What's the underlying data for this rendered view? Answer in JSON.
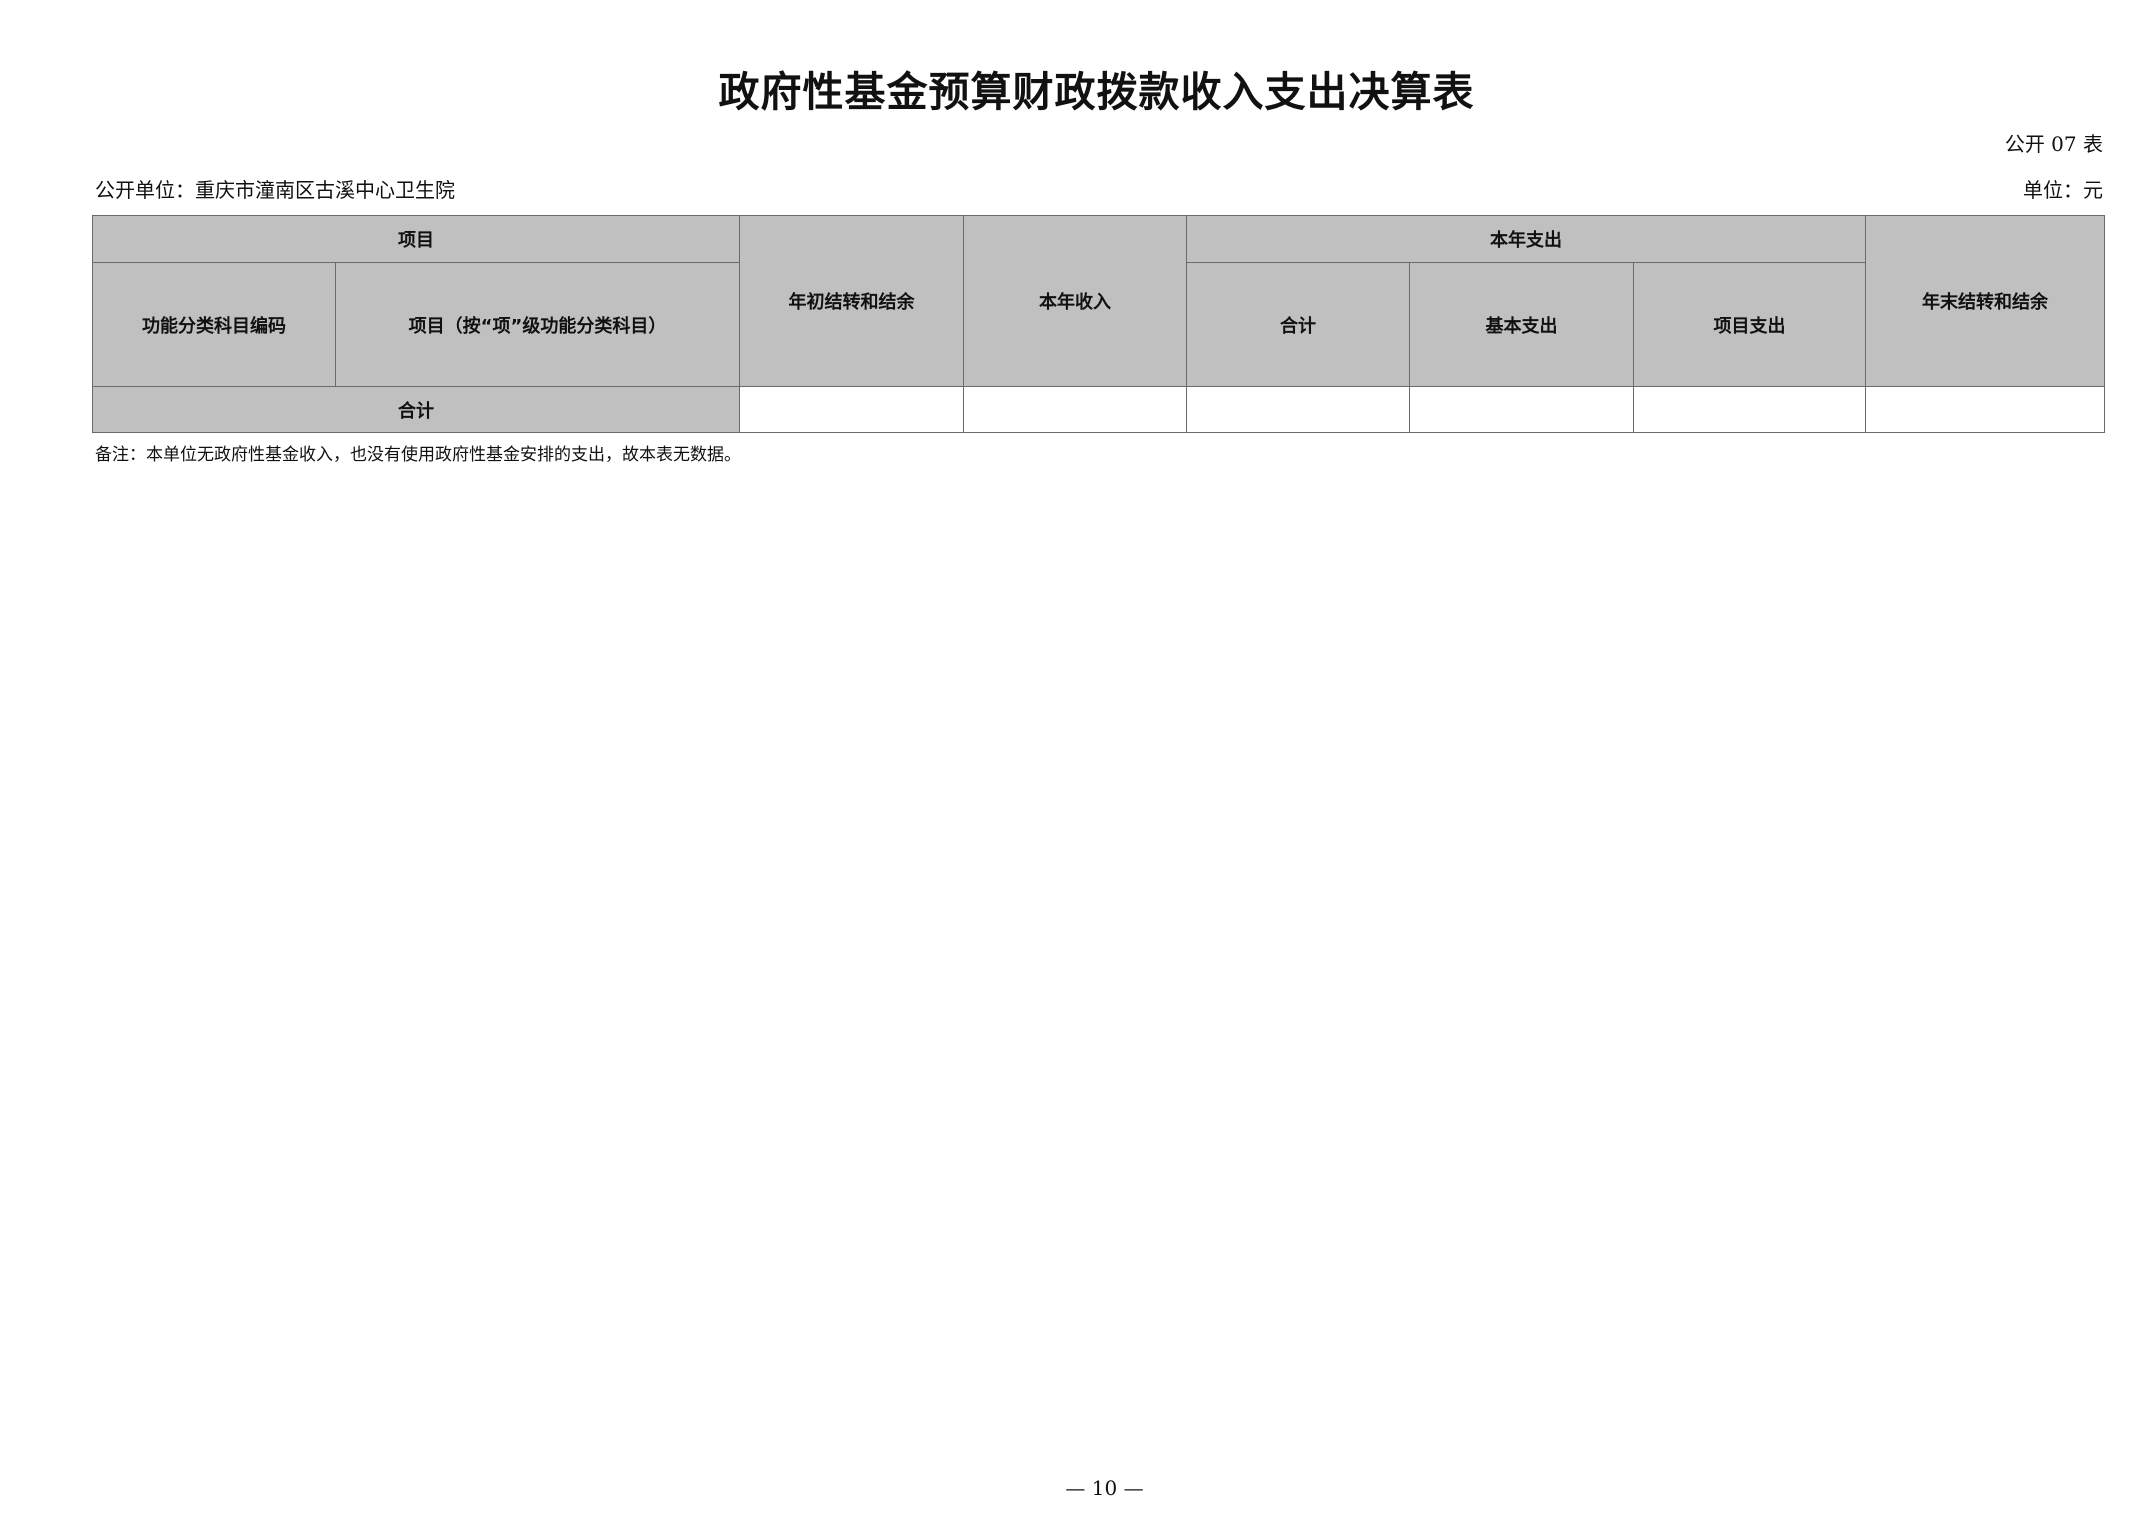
{
  "title": "政府性基金预算财政拨款收入支出决算表",
  "form_code": "公开 07 表",
  "unit_label": "公开单位：",
  "unit_name": "重庆市潼南区古溪中心卫生院",
  "currency_label": "单位：",
  "currency": "元",
  "table": {
    "header": {
      "item_group": "项目",
      "function_code": "功能分类科目编码",
      "item_name": "项目（按“项”级功能分类科目）",
      "opening_balance": "年初结转和结余",
      "current_income": "本年收入",
      "current_expense_group": "本年支出",
      "expense_total": "合计",
      "basic_expense": "基本支出",
      "project_expense": "项目支出",
      "closing_balance": "年末结转和结余"
    },
    "total_row": {
      "label": "合计",
      "opening_balance": "",
      "current_income": "",
      "expense_total": "",
      "basic_expense": "",
      "project_expense": "",
      "closing_balance": ""
    }
  },
  "note": "备注：本单位无政府性基金收入，也没有使用政府性基金安排的支出，故本表无数据。",
  "page_number": "— 10 —"
}
